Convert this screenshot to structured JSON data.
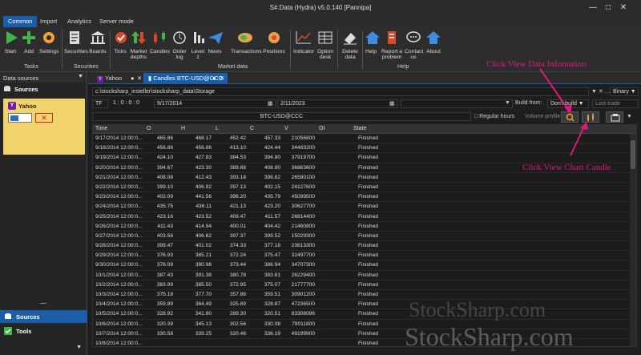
{
  "window": {
    "title": "S#.Data (Hydra) v5.0.140 [Pannipa]"
  },
  "menu": {
    "tabs": [
      "Common",
      "Import",
      "Analytics",
      "Server mode"
    ]
  },
  "ribbon": {
    "tasks_group": "Tasks",
    "securities_group": "Securities",
    "market_data_group": "Market data",
    "help_group": "Help",
    "buttons": {
      "start": "Start",
      "add": "Add",
      "settings": "Settings",
      "securities": "Securities",
      "boards": "Boards",
      "ticks": "Ticks",
      "market_depths": "Market depths",
      "candles": "Candles",
      "order_log": "Order log",
      "level1": "Level 1",
      "news": "News",
      "transactions": "Transactions",
      "positions": "Positions",
      "indicator": "Indicator",
      "option_desk": "Option desk",
      "delete_data": "Delete data",
      "help": "Help",
      "report_problem": "Report a problem",
      "contact_us": "Contact us",
      "about": "About"
    }
  },
  "sidebar": {
    "header": "Data sources",
    "sources_label": "Sources",
    "card_name": "Yahoo",
    "bottom_sources": "Sources",
    "bottom_tools": "Tools"
  },
  "doc_tabs": [
    {
      "label": "Yahoo"
    },
    {
      "label": "Candles BTC-USD@CCC"
    }
  ],
  "panel": {
    "path": "c:\\stocksharp_insteller\\stocksharp_data\\Storage",
    "format": "Binary",
    "tf_label": "TF",
    "timeframe": "1 : 0 : 0 : 0",
    "from_date": "9/17/2014",
    "to_date": "2/11/2023",
    "build_from_label": "Build from:",
    "build_value": "Don't build",
    "last_trade": "Last trade",
    "security": "BTC-USD@CCC",
    "regular_hours": "Regular hours",
    "volume_profile": "Volume profile"
  },
  "table": {
    "columns": [
      "Time",
      "O",
      "H",
      "L",
      "C",
      "V",
      "OI",
      "State"
    ],
    "rows": [
      [
        "9/17/2014 12:00:0...",
        "465.86",
        "468.17",
        "452.42",
        "457.33",
        "21056800",
        "",
        "Finished"
      ],
      [
        "9/18/2014 12:00:0...",
        "456.86",
        "456.86",
        "413.10",
        "424.44",
        "34483200",
        "",
        "Finished"
      ],
      [
        "9/19/2014 12:00:0...",
        "424.10",
        "427.83",
        "384.53",
        "394.80",
        "37919700",
        "",
        "Finished"
      ],
      [
        "9/20/2014 12:00:0...",
        "394.67",
        "423.30",
        "389.88",
        "408.90",
        "36863600",
        "",
        "Finished"
      ],
      [
        "9/21/2014 12:00:0...",
        "408.08",
        "412.43",
        "393.18",
        "398.82",
        "26580100",
        "",
        "Finished"
      ],
      [
        "9/22/2014 12:00:0...",
        "399.10",
        "406.92",
        "397.13",
        "402.15",
        "24127600",
        "",
        "Finished"
      ],
      [
        "9/23/2014 12:00:0...",
        "402.09",
        "441.56",
        "396.20",
        "435.79",
        "45099500",
        "",
        "Finished"
      ],
      [
        "9/24/2014 12:00:0...",
        "435.75",
        "436.11",
        "421.13",
        "423.20",
        "30627700",
        "",
        "Finished"
      ],
      [
        "9/25/2014 12:00:0...",
        "423.16",
        "423.52",
        "409.47",
        "411.57",
        "26814400",
        "",
        "Finished"
      ],
      [
        "9/26/2014 12:00:0...",
        "411.43",
        "414.94",
        "400.01",
        "404.42",
        "21460800",
        "",
        "Finished"
      ],
      [
        "9/27/2014 12:00:0...",
        "403.56",
        "406.62",
        "397.37",
        "399.52",
        "15029300",
        "",
        "Finished"
      ],
      [
        "9/28/2014 12:00:0...",
        "399.47",
        "401.02",
        "374.33",
        "377.18",
        "23613300",
        "",
        "Finished"
      ],
      [
        "9/29/2014 12:00:0...",
        "376.93",
        "385.21",
        "372.24",
        "375.47",
        "32497700",
        "",
        "Finished"
      ],
      [
        "9/30/2014 12:00:0...",
        "376.09",
        "390.98",
        "373.44",
        "386.94",
        "34707300",
        "",
        "Finished"
      ],
      [
        "10/1/2014 12:00:0...",
        "387.43",
        "391.38",
        "380.78",
        "383.61",
        "26229400",
        "",
        "Finished"
      ],
      [
        "10/2/2014 12:00:0...",
        "383.99",
        "385.50",
        "372.95",
        "375.07",
        "21777700",
        "",
        "Finished"
      ],
      [
        "10/3/2014 12:00:0...",
        "375.18",
        "377.70",
        "357.86",
        "359.51",
        "30901200",
        "",
        "Finished"
      ],
      [
        "10/4/2014 12:00:0...",
        "359.89",
        "364.49",
        "325.89",
        "328.87",
        "47236500",
        "",
        "Finished"
      ],
      [
        "10/5/2014 12:00:0...",
        "328.92",
        "341.80",
        "289.30",
        "320.51",
        "83308096",
        "",
        "Finished"
      ],
      [
        "10/6/2014 12:00:0...",
        "320.39",
        "345.13",
        "302.56",
        "330.08",
        "79011800",
        "",
        "Finished"
      ],
      [
        "10/7/2014 12:00:0...",
        "330.58",
        "339.25",
        "320.48",
        "336.19",
        "49199900",
        "",
        "Finished"
      ],
      [
        "10/8/2014 12:00:0...",
        "",
        "",
        "",
        "",
        "",
        "",
        "Finished"
      ]
    ]
  },
  "annotations": {
    "view_data_info": "Click View Data Infomation",
    "view_chart_candle": "Click View Chart Candle"
  },
  "watermark": "StockSharp.com"
}
